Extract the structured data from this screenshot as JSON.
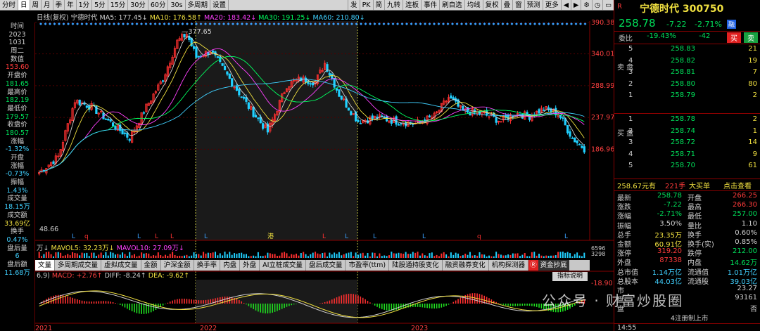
{
  "toolbar": {
    "left": [
      "分时",
      "日",
      "周",
      "月",
      "季",
      "年",
      "1分",
      "5分",
      "15分",
      "30分",
      "60分",
      "30s",
      "多周期",
      "设置"
    ],
    "right": [
      "发",
      "PK",
      "简",
      "九转",
      "连板",
      "事件",
      "刷自选",
      "均线",
      "复权",
      "叠",
      "窗",
      "预测",
      "更多"
    ],
    "active": "日",
    "ctrl_icons": [
      "prev-icon",
      "next-icon",
      "settings-icon",
      "history-icon",
      "restore-icon",
      "close-icon"
    ]
  },
  "ma_bar": {
    "mode": "日线(复权)",
    "name": "宁德时代",
    "ma5": "MA5: 177.45↓",
    "ma10": "MA10: 176.58↑",
    "ma20": "MA20: 183.42↓",
    "ma30": "MA30: 191.25↓",
    "ma60": "MA60: 210.80↓",
    "c5": "#d0d0d0",
    "c10": "#f0e040",
    "c20": "#ff40ff",
    "c30": "#00ff60",
    "c60": "#40d0ff"
  },
  "info_panel": [
    "时间",
    "2023",
    "1031",
    "周二",
    "数值",
    "153.60",
    "开盘价",
    "181.65",
    "最高价",
    "182.19",
    "最低价",
    "179.57",
    "收盘价",
    "180.57",
    "涨幅",
    "-1.32%",
    "开盘",
    "涨幅",
    "-0.73%",
    "振幅",
    "1.43%",
    "成交量",
    "18.15万",
    "成交额",
    "33.69亿",
    "换手",
    "0.47%",
    "盘后量",
    "6",
    "盘后额",
    "11.68万"
  ],
  "info_colors": [
    "w",
    "w",
    "w",
    "w",
    "w",
    "r",
    "w",
    "g",
    "w",
    "g",
    "w",
    "g",
    "w",
    "g",
    "w",
    "c",
    "w",
    "w",
    "c",
    "w",
    "c",
    "w",
    "c",
    "w",
    "y",
    "w",
    "c",
    "w",
    "c",
    "w",
    "c"
  ],
  "price_axis": {
    "labels": [
      "390.38",
      "340.01",
      "288.99",
      "237.97",
      "186.96"
    ],
    "low_label": "48.66",
    "peak_label": "377.65"
  },
  "volume": {
    "title": "万↓",
    "mavol5": "MAVOL5: 32.23万↓",
    "mavol10": "MAVOL10: 27.09万↓",
    "mini_labels": [
      "6596",
      "3298"
    ]
  },
  "tabs": {
    "first": "文量",
    "items": [
      "多周期成交量",
      "虚拟成交量",
      "金额",
      "沪深金额",
      "换手率",
      "内盘",
      "外盘",
      "AI立桩成交量",
      "盘后成交量",
      "市盈率(ttm)",
      "陆股通持股变化",
      "融资融券变化",
      "机构探测器"
    ],
    "fund": "资金抄底",
    "badge": "Ⓡ"
  },
  "macd": {
    "params": "6,9)",
    "macd": "MACD: +2.76↑",
    "diff": "DIFF: -8.24↑",
    "dea": "DEA: -9.62↑",
    "label": "-18.90",
    "guide": "指标说明",
    "x_labels": [
      "2022",
      "2023"
    ],
    "x_edge": "2021"
  },
  "chart_data": {
    "type": "candlestick",
    "symbol": "宁德时代",
    "period": "日线(复权)",
    "x_range": [
      "2021",
      "2023-10-31"
    ],
    "ylim": [
      48.66,
      390.38
    ],
    "ytick_labels": [
      390.38,
      340.01,
      288.99,
      237.97,
      186.96
    ],
    "peak": 377.65,
    "last": {
      "date": "2023-10-31",
      "open": 181.65,
      "high": 182.19,
      "low": 179.57,
      "close": 180.57,
      "pct": -1.32
    }
  },
  "quote": {
    "title": "宁德时代 300750",
    "price": "258.78",
    "change": "-7.22",
    "pct": "-2.71%",
    "badge": "融",
    "weibi_label": "委比",
    "weibi": "-19.43%",
    "weicha": "-42",
    "buy": "买",
    "sell": "卖",
    "side_sell": "卖 盘",
    "side_buy": "买 盘"
  },
  "asks": [
    [
      "5",
      "258.83",
      "21"
    ],
    [
      "4",
      "258.82",
      "19"
    ],
    [
      "3",
      "258.81",
      "7"
    ],
    [
      "2",
      "258.80",
      "80"
    ],
    [
      "1",
      "258.79",
      "2"
    ]
  ],
  "bids": [
    [
      "1",
      "258.78",
      "2"
    ],
    [
      "2",
      "258.74",
      "1"
    ],
    [
      "3",
      "258.72",
      "14"
    ],
    [
      "4",
      "258.71",
      "9"
    ],
    [
      "5",
      "258.70",
      "61"
    ]
  ],
  "trade": {
    "price": "258.67元有",
    "vol": "221手",
    "act": "大买单",
    "link": "点击查看"
  },
  "stats": [
    [
      "最新",
      "258.78",
      "开盘",
      "266.25"
    ],
    [
      "涨跌",
      "-7.22",
      "最高",
      "266.30"
    ],
    [
      "涨幅",
      "-2.71%",
      "最低",
      "257.00"
    ],
    [
      "振幅",
      "3.50%",
      "量比",
      "1.10"
    ],
    [
      "总手",
      "23.35万",
      "换手",
      "0.60%"
    ],
    [
      "金额",
      "60.91亿",
      "换手(实)",
      "0.85%"
    ],
    [
      "涨停",
      "319.20",
      "跌停",
      "212.00"
    ],
    [
      "外盘",
      "87338",
      "内盘",
      "14.62万"
    ],
    [
      "总市值",
      "1.14万亿",
      "流通值",
      "1.01万亿"
    ],
    [
      "总股本",
      "44.03亿",
      "流通股",
      "39.03亿"
    ],
    [
      "市",
      "",
      "",
      "23.27"
    ],
    [
      "盘",
      "",
      "",
      "93161"
    ],
    [
      "盘",
      "",
      "",
      "否"
    ]
  ],
  "stat_colors": [
    [
      "w",
      "g",
      "w",
      "r"
    ],
    [
      "w",
      "g",
      "w",
      "r"
    ],
    [
      "w",
      "g",
      "w",
      "g"
    ],
    [
      "w",
      "w",
      "w",
      "w"
    ],
    [
      "w",
      "y",
      "w",
      "w"
    ],
    [
      "w",
      "y",
      "w",
      "w"
    ],
    [
      "w",
      "r",
      "w",
      "g"
    ],
    [
      "w",
      "r",
      "w",
      "g"
    ],
    [
      "w",
      "c",
      "w",
      "c"
    ],
    [
      "w",
      "c",
      "w",
      "c"
    ],
    [
      "w",
      "w",
      "w",
      "w"
    ],
    [
      "w",
      "w",
      "w",
      "w"
    ],
    [
      "w",
      "w",
      "w",
      "w"
    ]
  ],
  "stat_under": "4注册制上市",
  "bottom_row": "14:55",
  "watermark": "公众号 · 财富炒股圈"
}
